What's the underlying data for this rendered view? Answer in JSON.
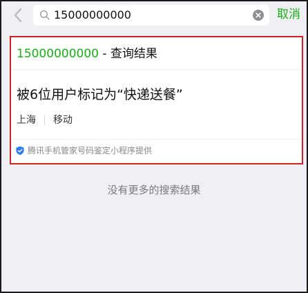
{
  "search": {
    "query": "15000000000",
    "cancel_label": "取消"
  },
  "result": {
    "number": "15000000000",
    "title_separator": " - ",
    "title_suffix": "查询结果",
    "headline": "被6位用户标记为“快递送餐”",
    "region": "上海",
    "carrier": "移动",
    "provider": "腾讯手机管家号码鉴定小程序提供"
  },
  "no_more_results": "没有更多的搜索结果",
  "colors": {
    "accent_green": "#1aad19",
    "highlight_red": "#d0202a",
    "background": "#efeff4"
  },
  "icons": {
    "back": "chevron-left-icon",
    "search": "search-icon",
    "clear": "clear-icon",
    "provider": "shield-icon"
  }
}
